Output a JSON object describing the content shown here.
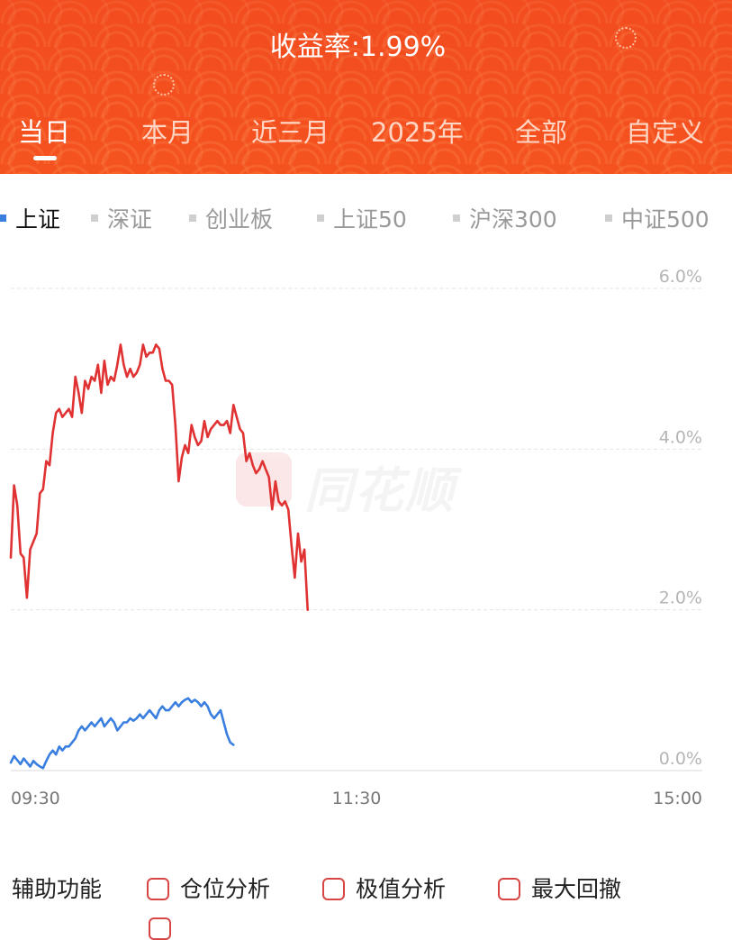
{
  "header": {
    "title": "收益率:1.99%",
    "tabs": [
      "当日",
      "本月",
      "近三月",
      "2025年",
      "全部",
      "自定义"
    ],
    "active_tab": 0
  },
  "index_tabs": [
    "上证",
    "深证",
    "创业板",
    "上证50",
    "沪深300",
    "中证500"
  ],
  "active_index_tab": 0,
  "watermark": "同花顺",
  "functions": {
    "label": "辅助功能",
    "items": [
      "仓位分析",
      "极值分析",
      "最大回撤"
    ]
  },
  "colors": {
    "accent": "#f4521f",
    "portfolio_line": "#e03232",
    "index_line": "#3a7fe0",
    "checkbox": "#d84545"
  },
  "chart_data": {
    "type": "line",
    "y_ticks": [
      "6.0%",
      "4.0%",
      "2.0%",
      "0.0%"
    ],
    "x_ticks": [
      "09:30",
      "11:30",
      "15:00"
    ],
    "ylim": [
      0,
      6
    ],
    "grid": true,
    "series": [
      {
        "values": [
          2.65,
          3.55,
          3.3,
          2.7,
          2.65,
          2.15,
          2.75,
          2.85,
          2.95,
          3.45,
          3.5,
          3.85,
          3.8,
          4.2,
          4.45,
          4.5,
          4.4,
          4.45,
          4.5,
          4.4,
          4.9,
          4.7,
          4.45,
          4.85,
          4.75,
          4.9,
          4.85,
          5.05,
          4.7,
          5.1,
          4.8,
          4.9,
          4.85,
          5.05,
          5.3,
          5.05,
          4.9,
          5.0,
          4.9,
          4.95,
          5.05,
          5.3,
          5.15,
          5.2,
          5.2,
          5.3,
          5.25,
          5.0,
          4.85,
          4.85,
          4.8,
          4.3,
          3.6,
          3.9,
          4.05,
          3.95,
          4.3,
          4.15,
          4.05,
          4.1,
          4.35,
          4.15,
          4.25,
          4.3,
          4.35,
          4.3,
          4.3,
          4.35,
          4.2,
          4.55,
          4.4,
          4.25,
          4.2,
          3.85,
          3.95,
          3.8,
          3.7,
          3.75,
          3.85,
          3.75,
          3.65,
          3.25,
          3.6,
          3.35,
          3.3,
          3.35,
          3.25,
          2.8,
          2.4,
          2.95,
          2.6,
          2.75,
          2.0
        ]
      },
      {
        "values": [
          0.1,
          0.18,
          0.13,
          0.08,
          0.15,
          0.1,
          0.05,
          0.12,
          0.08,
          0.05,
          0.03,
          0.12,
          0.2,
          0.25,
          0.2,
          0.3,
          0.25,
          0.3,
          0.3,
          0.35,
          0.4,
          0.5,
          0.55,
          0.5,
          0.55,
          0.6,
          0.55,
          0.6,
          0.65,
          0.55,
          0.6,
          0.65,
          0.6,
          0.5,
          0.55,
          0.6,
          0.6,
          0.65,
          0.62,
          0.65,
          0.7,
          0.65,
          0.7,
          0.75,
          0.7,
          0.65,
          0.75,
          0.8,
          0.75,
          0.75,
          0.8,
          0.85,
          0.8,
          0.85,
          0.88,
          0.9,
          0.85,
          0.88,
          0.85,
          0.8,
          0.85,
          0.8,
          0.7,
          0.65,
          0.7,
          0.75,
          0.6,
          0.45,
          0.35,
          0.32
        ]
      }
    ]
  }
}
